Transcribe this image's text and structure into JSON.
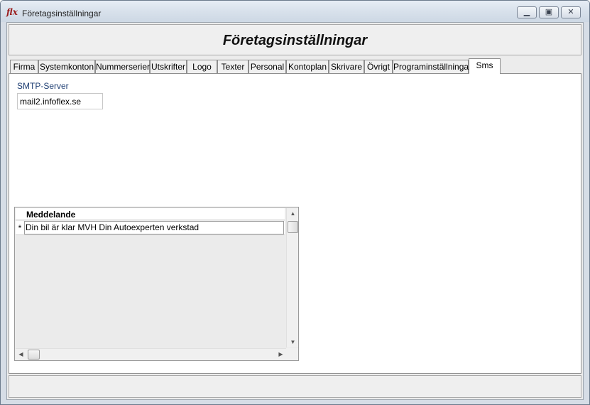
{
  "window": {
    "title": "Företagsinställningar",
    "app_icon": "flx",
    "buttons": {
      "minimize": "minimize-icon",
      "maximize": "maximize-icon",
      "close": "close-icon"
    }
  },
  "header": {
    "title": "Företagsinställningar"
  },
  "tabs": [
    {
      "label": "Firma"
    },
    {
      "label": "Systemkonton"
    },
    {
      "label": "Nummerserier"
    },
    {
      "label": "Utskrifter"
    },
    {
      "label": "Logo"
    },
    {
      "label": "Texter"
    },
    {
      "label": "Personal"
    },
    {
      "label": "Kontoplan"
    },
    {
      "label": "Skrivare"
    },
    {
      "label": "Övrigt"
    },
    {
      "label": "Programinställningar"
    },
    {
      "label": "Sms"
    }
  ],
  "active_tab": "Sms",
  "sms": {
    "smtp_label": "SMTP-Server",
    "smtp_value": "mail2.infoflex.se",
    "grid": {
      "column_header": "Meddelande",
      "rows": [
        {
          "marker": "*",
          "message": "Din bil är klar MVH Din Autoexperten verkstad"
        }
      ]
    }
  },
  "colors": {
    "accent_label": "#1f3f73",
    "window_frame": "#d6dde6"
  }
}
